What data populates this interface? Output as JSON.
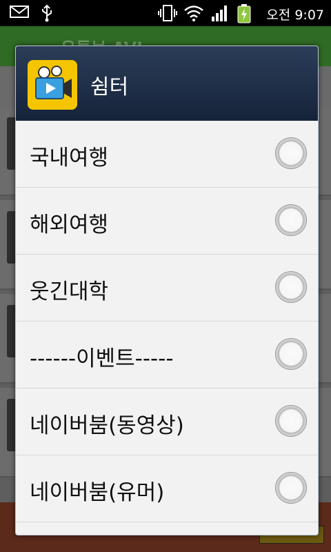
{
  "status_bar": {
    "time": "오전 9:07",
    "icons": [
      "mail-icon",
      "usb-icon",
      "vibrate-icon",
      "wifi-icon",
      "signal-icon",
      "battery-icon"
    ]
  },
  "background_app": {
    "title": "유튜브 AVI"
  },
  "dialog": {
    "title": "쉼터",
    "icon": "video-camera-icon",
    "options": [
      {
        "label": "국내여행",
        "selected": false
      },
      {
        "label": "해외여행",
        "selected": false
      },
      {
        "label": "웃긴대학",
        "selected": false
      },
      {
        "label": "------이벤트-----",
        "selected": false
      },
      {
        "label": "네이버붐(동영상)",
        "selected": false
      },
      {
        "label": "네이버붐(유머)",
        "selected": false
      }
    ]
  },
  "colors": {
    "dialog_header": "#1d2c46",
    "dialog_icon_bg": "#f4c500",
    "option_bg": "#f2f2f2",
    "status_bar": "#000000"
  }
}
